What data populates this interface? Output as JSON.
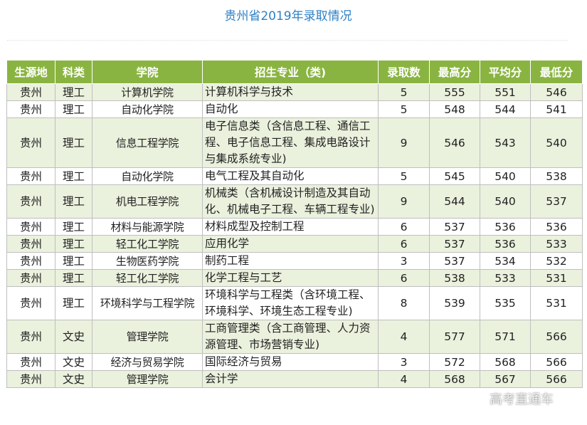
{
  "title": "贵州省2019年录取情况",
  "headers": [
    "生源地",
    "科类",
    "学院",
    "招生专业（类)",
    "录取数",
    "最高分",
    "平均分",
    "最低分"
  ],
  "rows": [
    {
      "origin": "贵州",
      "category": "理工",
      "college": "计算机学院",
      "major": "计算机科学与技术",
      "admitted": "5",
      "max": "555",
      "avg": "551",
      "min": "546"
    },
    {
      "origin": "贵州",
      "category": "理工",
      "college": "自动化学院",
      "major": "自动化",
      "admitted": "5",
      "max": "548",
      "avg": "544",
      "min": "541"
    },
    {
      "origin": "贵州",
      "category": "理工",
      "college": "信息工程学院",
      "major": "电子信息类（含信息工程、通信工程、电子信息工程、集成电路设计与集成系统专业)",
      "admitted": "9",
      "max": "546",
      "avg": "543",
      "min": "540"
    },
    {
      "origin": "贵州",
      "category": "理工",
      "college": "自动化学院",
      "major": "电气工程及其自动化",
      "admitted": "5",
      "max": "545",
      "avg": "540",
      "min": "538"
    },
    {
      "origin": "贵州",
      "category": "理工",
      "college": "机电工程学院",
      "major": "机械类（含机械设计制造及其自动化、机械电子工程、车辆工程专业)",
      "admitted": "9",
      "max": "544",
      "avg": "540",
      "min": "537"
    },
    {
      "origin": "贵州",
      "category": "理工",
      "college": "材料与能源学院",
      "major": "材料成型及控制工程",
      "admitted": "6",
      "max": "537",
      "avg": "536",
      "min": "536"
    },
    {
      "origin": "贵州",
      "category": "理工",
      "college": "轻工化工学院",
      "major": "应用化学",
      "admitted": "6",
      "max": "537",
      "avg": "536",
      "min": "533"
    },
    {
      "origin": "贵州",
      "category": "理工",
      "college": "生物医药学院",
      "major": "制药工程",
      "admitted": "3",
      "max": "537",
      "avg": "534",
      "min": "532"
    },
    {
      "origin": "贵州",
      "category": "理工",
      "college": "轻工化工学院",
      "major": "化学工程与工艺",
      "admitted": "6",
      "max": "538",
      "avg": "533",
      "min": "531"
    },
    {
      "origin": "贵州",
      "category": "理工",
      "college": "环境科学与工程学院",
      "major": "环境科学与工程类（含环境工程、环境科学、环境生态工程专业)",
      "admitted": "8",
      "max": "539",
      "avg": "535",
      "min": "531"
    },
    {
      "origin": "贵州",
      "category": "文史",
      "college": "管理学院",
      "major": "工商管理类（含工商管理、人力资源管理、市场营销专业)",
      "admitted": "4",
      "max": "577",
      "avg": "571",
      "min": "566"
    },
    {
      "origin": "贵州",
      "category": "文史",
      "college": "经济与贸易学院",
      "major": "国际经济与贸易",
      "admitted": "3",
      "max": "572",
      "avg": "568",
      "min": "566"
    },
    {
      "origin": "贵州",
      "category": "文史",
      "college": "管理学院",
      "major": "会计学",
      "admitted": "4",
      "max": "568",
      "avg": "567",
      "min": "566"
    }
  ],
  "watermark": "高考直通车"
}
